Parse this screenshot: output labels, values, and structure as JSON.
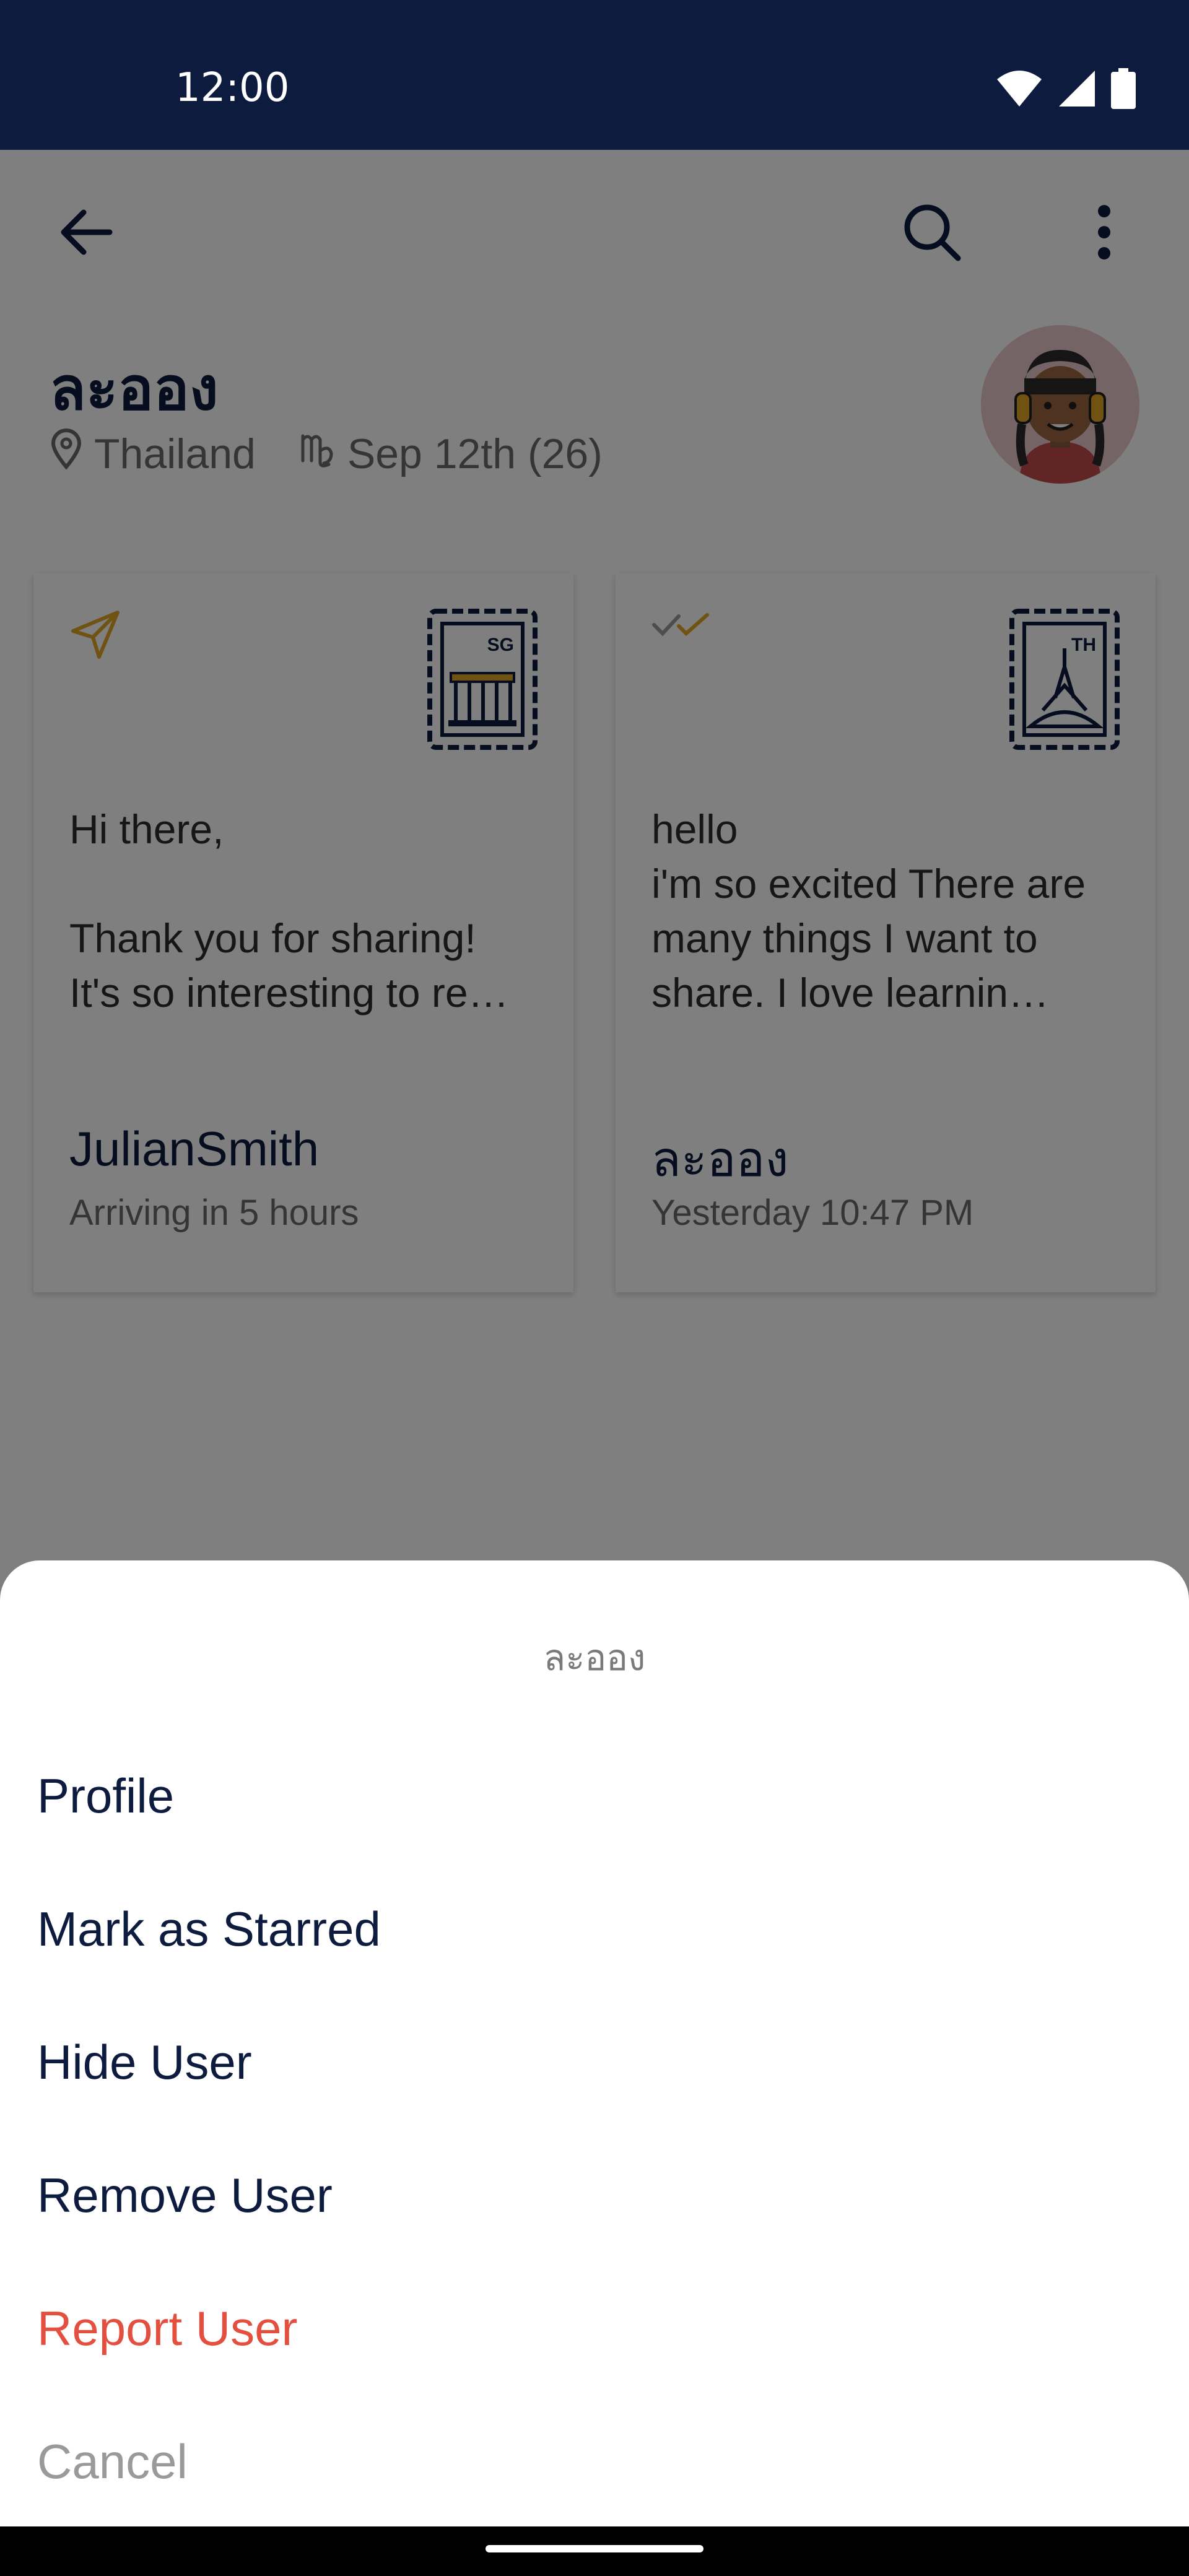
{
  "status_bar": {
    "time": "12:00",
    "icons": [
      "wifi-icon",
      "cell-signal-icon",
      "battery-icon"
    ],
    "background": "#0d1b3e"
  },
  "toolbar": {
    "back_icon": "arrow-left-icon",
    "search_icon": "search-icon",
    "more_icon": "more-vertical-icon"
  },
  "profile": {
    "name": "ละออง",
    "country": "Thailand",
    "birthday": "Sep 12th (26)",
    "location_icon": "location-pin-icon",
    "zodiac_icon": "virgo-icon",
    "avatar_icon": "avatar-girl-headphones"
  },
  "letters": [
    {
      "status_icon": "sent-icon",
      "stamp_code": "SG",
      "body": "Hi there,\n\nThank you for sharing!\nIt's so interesting to re…",
      "author": "JulianSmith",
      "time": "Arriving in 5 hours"
    },
    {
      "status_icon": "double-check-icon",
      "stamp_code": "TH",
      "body": "hello\n    i'm so excited There are many things I want to share. I love learnin…",
      "author": "ละออง",
      "time": "Yesterday 10:47 PM"
    }
  ],
  "sheet": {
    "title": "ละออง",
    "items": {
      "profile": "Profile",
      "star": "Mark as Starred",
      "hide": "Hide User",
      "remove": "Remove User",
      "report": "Report User",
      "cancel": "Cancel"
    }
  },
  "colors": {
    "accent": "#e0a526",
    "navy": "#0d1b3e",
    "danger": "#e4503f"
  }
}
